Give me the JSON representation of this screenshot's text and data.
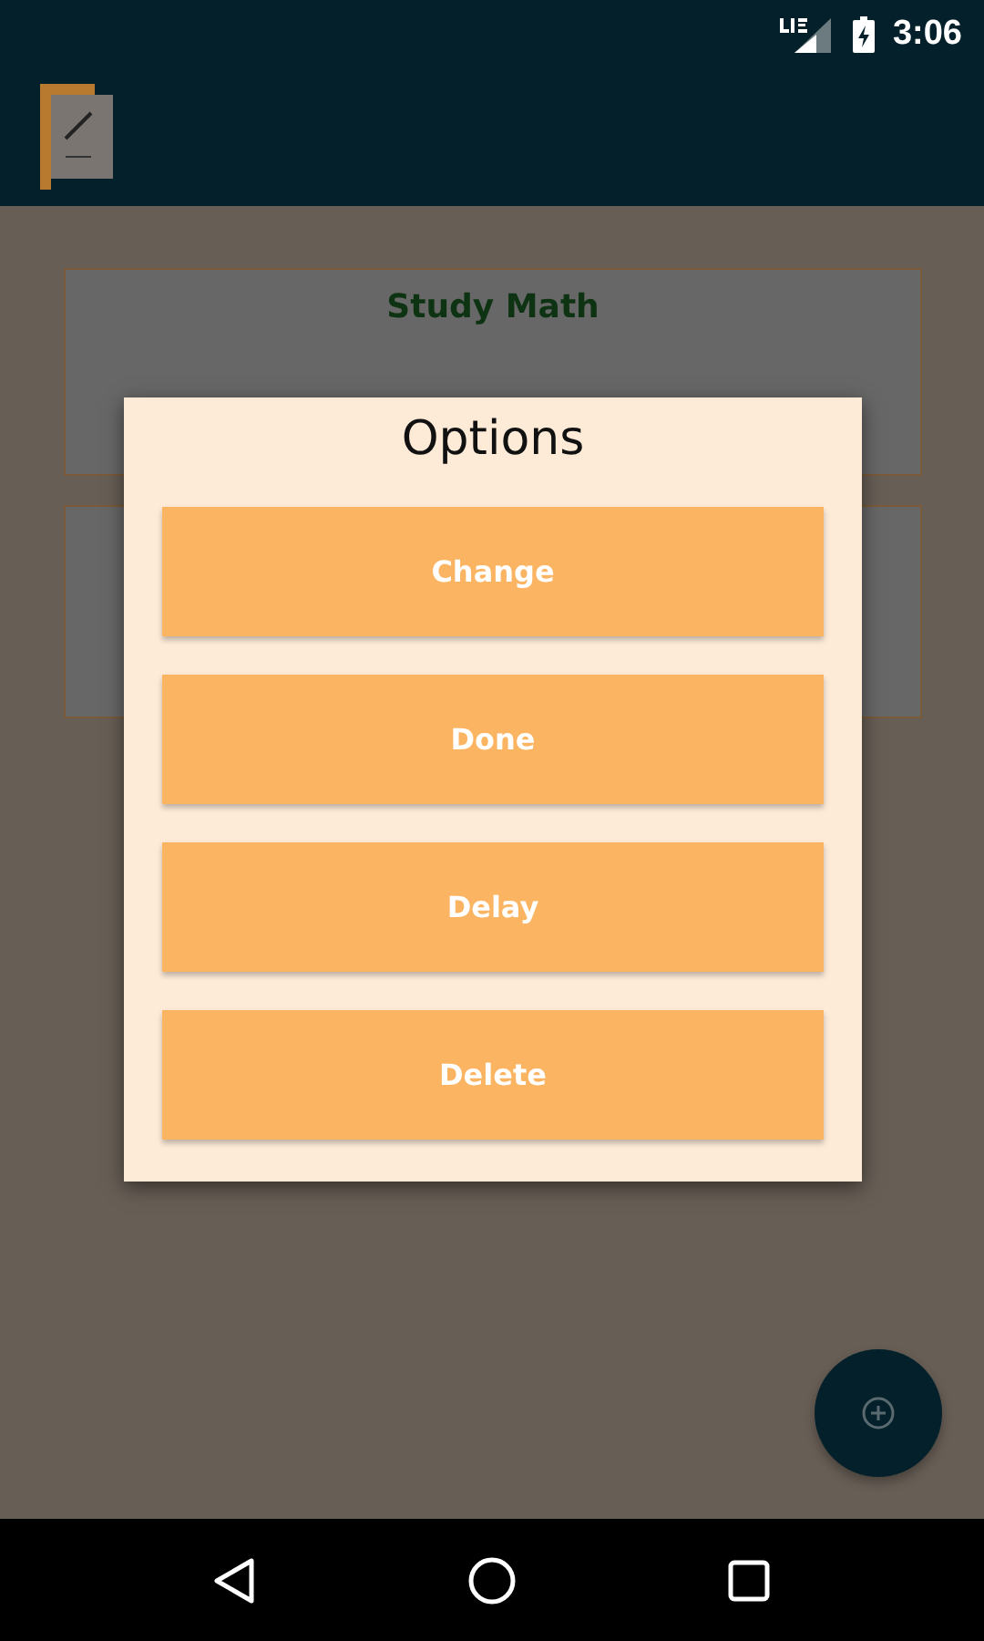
{
  "status_bar": {
    "time": "3:06"
  },
  "cards": [
    {
      "kind": "titled",
      "title": "Study Math"
    },
    {
      "kind": "blank"
    }
  ],
  "dialog": {
    "title": "Options",
    "buttons": [
      "Change",
      "Done",
      "Delay",
      "Delete"
    ]
  }
}
